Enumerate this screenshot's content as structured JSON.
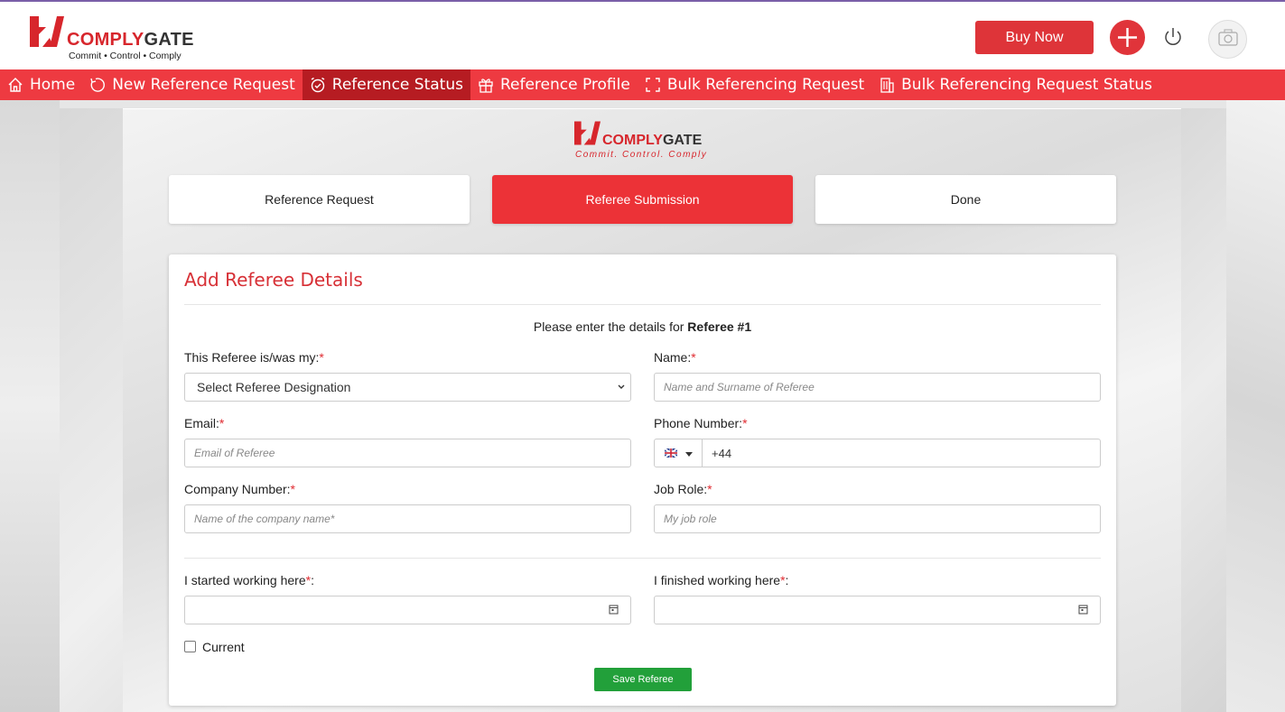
{
  "header": {
    "logo": {
      "brand_left": "COMPLY",
      "brand_right": "GATE",
      "tagline": "Commit • Control • Comply"
    },
    "buy_label": "Buy Now",
    "accent": "#ee3a41"
  },
  "nav": {
    "items": [
      {
        "label": "Home",
        "icon": "home-icon"
      },
      {
        "label": "New Reference Request",
        "icon": "refresh-icon"
      },
      {
        "label": "Reference Status",
        "icon": "alarm-check-icon",
        "active": true
      },
      {
        "label": "Reference Profile",
        "icon": "gift-icon"
      },
      {
        "label": "Bulk Referencing Request",
        "icon": "expand-icon"
      },
      {
        "label": "Bulk Referencing Request Status",
        "icon": "building-icon"
      }
    ]
  },
  "center_logo": {
    "brand_left": "COMPLY",
    "brand_right": "GATE",
    "tagline": "Commit. Control. Comply"
  },
  "steps": [
    {
      "label": "Reference Request"
    },
    {
      "label": "Referee Submission",
      "active": true
    },
    {
      "label": "Done"
    }
  ],
  "form": {
    "title": "Add Referee Details",
    "intro_prefix": "Please enter the details for",
    "intro_bold": "Referee #1",
    "designation": {
      "label": "This Referee is/was my:",
      "selected": "Select Referee Designation"
    },
    "name": {
      "label": "Name:",
      "placeholder": "Name and Surname of Referee"
    },
    "email": {
      "label": "Email:",
      "placeholder": "Email of Referee"
    },
    "phone": {
      "label": "Phone Number:",
      "value": "+44"
    },
    "company": {
      "label": "Company Number:",
      "placeholder": "Name of the company name*"
    },
    "job_role": {
      "label": "Job Role:",
      "placeholder": "My job role"
    },
    "started": {
      "label": "I started working here"
    },
    "finished": {
      "label": "I finished working here"
    },
    "required_mark": "*",
    "colon": ":",
    "current_label": "Current",
    "save_label": "Save Referee"
  }
}
